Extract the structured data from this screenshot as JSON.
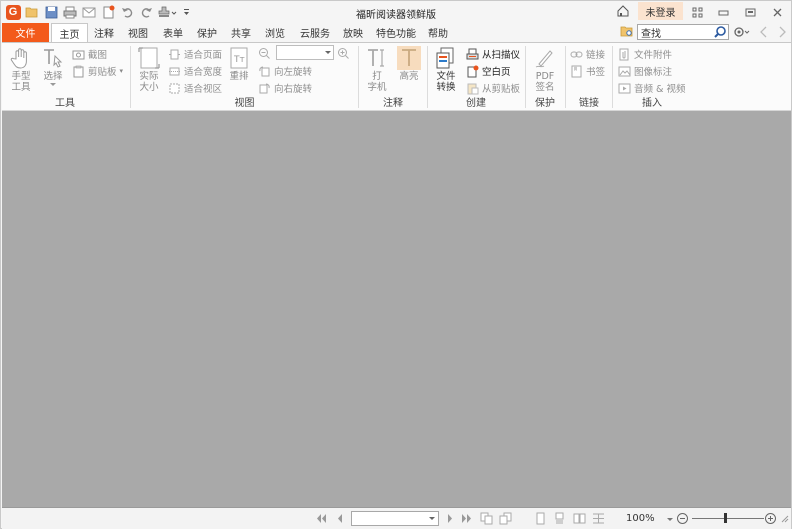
{
  "window": {
    "title": "福昕阅读器领鲜版",
    "login_label": "未登录"
  },
  "tabs": {
    "file": "文件",
    "items": [
      "主页",
      "注释",
      "视图",
      "表单",
      "保护",
      "共享",
      "浏览",
      "云服务",
      "放映",
      "特色功能",
      "帮助"
    ],
    "active_index": 0
  },
  "search": {
    "value": "查找"
  },
  "ribbon": {
    "tools": {
      "label": "工具",
      "hand": "手型\n工具",
      "select": "选择",
      "screenshot": "截图",
      "clipboard": "剪贴板"
    },
    "view": {
      "label": "视图",
      "actual_size": "实际\n大小",
      "fit_page": "适合页面",
      "fit_width": "适合宽度",
      "fit_visible": "适合视区",
      "reflow": "重排",
      "rotate_left": "向左旋转",
      "rotate_right": "向右旋转"
    },
    "annotate": {
      "label": "注释",
      "typewriter": "打\n字机",
      "highlight": "高亮"
    },
    "create": {
      "label": "创建",
      "convert": "文件\n转换",
      "from_scanner": "从扫描仪",
      "blank_page": "空白页",
      "from_clipboard": "从剪贴板"
    },
    "protect": {
      "label": "保护",
      "pdf_sign": "PDF\n签名"
    },
    "links": {
      "label": "链接",
      "link": "链接",
      "bookmark": "书签"
    },
    "insert": {
      "label": "插入",
      "file_attachment": "文件附件",
      "image_annotation": "图像标注",
      "audio_video": "音频 & 视频"
    }
  },
  "status": {
    "zoom": "100%",
    "zoom_level": 0.47
  },
  "colors": {
    "accent": "#f35a1b",
    "login_bg": "#fbe3cf",
    "doc_bg": "#a9a9a9"
  }
}
